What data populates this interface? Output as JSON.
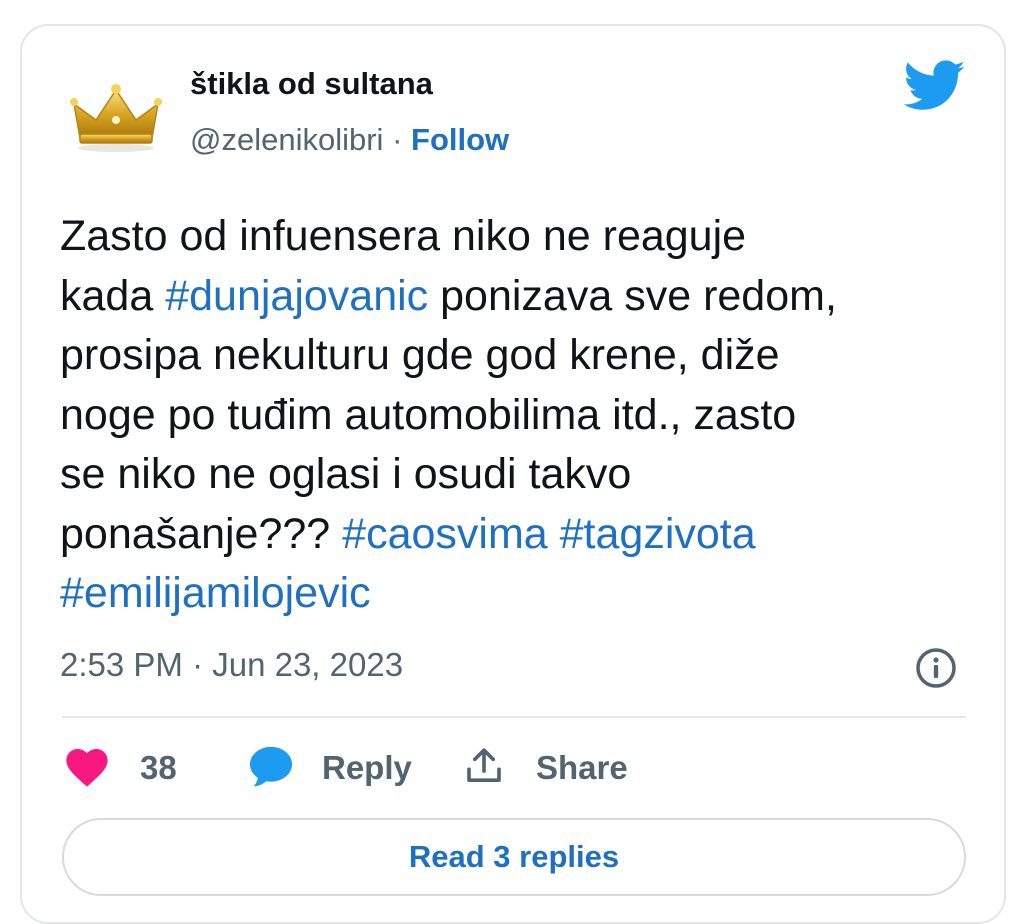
{
  "author": {
    "name": "štikla od sultana",
    "handle": "@zelenikolibri",
    "separator": "·",
    "follow_label": "Follow"
  },
  "tweet": {
    "lines": [
      [
        {
          "text": "Zasto od infuensera niko ne reaguje"
        }
      ],
      [
        {
          "text": "kada "
        },
        {
          "text": "#dunjajovanic",
          "tag": true
        },
        {
          "text": " ponizava sve redom,"
        }
      ],
      [
        {
          "text": "prosipa nekulturu gde god krene, diže"
        }
      ],
      [
        {
          "text": "noge po tuđim automobilima itd., zasto"
        }
      ],
      [
        {
          "text": "se niko ne oglasi i osudi takvo"
        }
      ],
      [
        {
          "text": "ponašanje??? "
        },
        {
          "text": "#caosvima",
          "tag": true
        },
        {
          "text": " "
        },
        {
          "text": "#tagzivota",
          "tag": true
        }
      ],
      [
        {
          "text": "#emilijamilojevic",
          "tag": true
        }
      ]
    ],
    "timestamp": "2:53 PM · Jun 23, 2023"
  },
  "actions": {
    "like_count": "38",
    "reply_label": "Reply",
    "share_label": "Share"
  },
  "read_replies_label": "Read 3 replies",
  "icons": {
    "avatar": "crown-icon",
    "brand": "twitter-bird-icon",
    "info": "info-icon",
    "like": "heart-icon",
    "reply": "speech-bubble-icon",
    "share": "share-upload-icon"
  },
  "colors": {
    "link": "#1d70c2",
    "brand": "#1d9bf0",
    "like": "#f91880",
    "text": "#0f1419",
    "muted": "#536471"
  }
}
